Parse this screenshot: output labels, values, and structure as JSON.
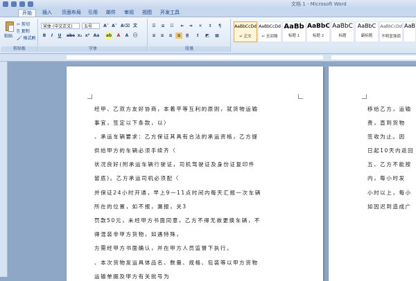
{
  "window": {
    "title": "文档 1 - Microsoft Word"
  },
  "tabs": [
    "开始",
    "插入",
    "页面布局",
    "引用",
    "邮件",
    "审阅",
    "视图",
    "开发工具"
  ],
  "clipboard": {
    "paste": "粘贴",
    "cut": "剪切",
    "copy": "复制",
    "format_painter": "格式刷",
    "group_label": "剪贴板"
  },
  "font": {
    "name": "宋体 (中文正文)",
    "size": "五号",
    "group_label": "字体"
  },
  "paragraph": {
    "group_label": "段落"
  },
  "styles": [
    {
      "sample": "AaBbCcDd",
      "name": "↵ 正文"
    },
    {
      "sample": "AaBbCcDd",
      "name": "↵ 无间隔"
    },
    {
      "sample": "AaBb",
      "name": "标题 1"
    },
    {
      "sample": "AaBbC",
      "name": "标题 2"
    },
    {
      "sample": "AaBbC",
      "name": "标题"
    },
    {
      "sample": "AaBbC",
      "name": "副标题"
    },
    {
      "sample": "AaBbCcDd",
      "name": "不明显强调"
    },
    {
      "sample": "AaBbC",
      "name": ""
    }
  ],
  "document": {
    "page1_lines": [
      "经甲、乙双方友好协商，本着平等互利的原则，就货物运输",
      "事宜，签定以下条款，以〉",
      "、承运车辆要求：乙方保证其具有合法的承运资格，乙方提",
      "供给甲方的车辆必须手续齐〈",
      "状况良好(附承运车辆行驶证，司机驾驶证及身份证复印件",
      "留底)。乙方承运司机必须配〈",
      "并保证24小时开通，早上9一11点时间内每天汇报一次车辆",
      "所在的位置，如不报，漏报，关3",
      "罚款50元，未经甲方书面同意，乙方不得无故更换车辆，不",
      "得混装非甲方货物，如遇特殊，",
      "方需经甲方书面确认，并在甲方人员监督下执行。",
      "、本次货物发运具体品名、数量、规格、包装等以甲方货物",
      "运输单据及甲方有关批号为"
    ],
    "page2_lines": [
      "移给乙方，运输",
      "责，直到货物",
      "签收为止。因",
      "日起10天内返回",
      "五、乙方不能按",
      "内，每小时发",
      "小时以上，每小",
      "如因迟到造成广"
    ]
  }
}
